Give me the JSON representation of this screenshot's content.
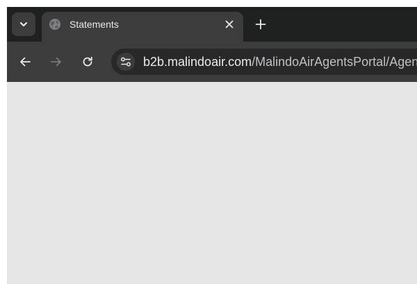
{
  "browser": {
    "tab": {
      "title": "Statements",
      "favicon_icon": "globe-icon",
      "close_icon": "close-icon"
    },
    "tab_search_icon": "chevron-down-icon",
    "new_tab_icon": "plus-icon",
    "toolbar": {
      "back_icon": "arrow-left-icon",
      "forward_icon": "arrow-right-icon",
      "reload_icon": "reload-icon",
      "site_info_icon": "tune-icon"
    },
    "address_bar": {
      "host": "b2b.malindoair.com",
      "path": "/MalindoAirAgentsPortal/Agent"
    }
  },
  "colors": {
    "tabstrip_bg": "#1f2020",
    "toolbar_bg": "#3c3c3c",
    "omnibox_bg": "#282828",
    "content_bg": "#e6e6e6",
    "text_primary": "#e8eaed",
    "text_secondary": "#bdc1c6",
    "icon_disabled": "#7a7a7a"
  }
}
